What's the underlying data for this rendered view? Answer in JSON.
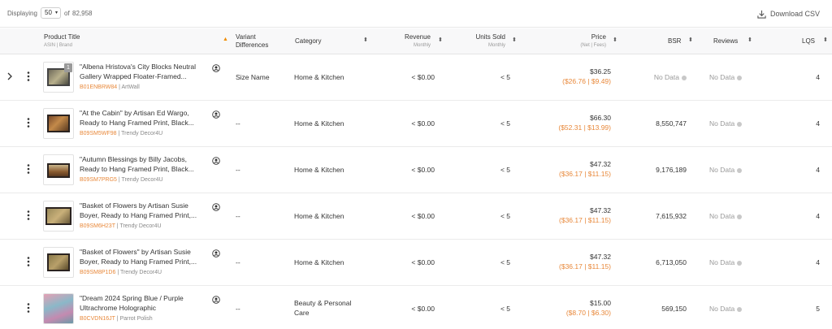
{
  "toolbar": {
    "displaying_label": "Displaying",
    "page_size": "50",
    "of_label": "of",
    "total": "82,958",
    "download_label": "Download CSV"
  },
  "columns": {
    "product_title": "Product Title",
    "product_sub": "ASIN | Brand",
    "variant": "Variant\nDifferences",
    "category": "Category",
    "revenue": "Revenue",
    "revenue_sub": "Monthly",
    "units": "Units Sold",
    "units_sub": "Monthly",
    "price": "Price",
    "price_sub": "(Net | Fees)",
    "bsr": "BSR",
    "reviews": "Reviews",
    "lqs": "LQS"
  },
  "rows": [
    {
      "title": "\"Albena Hristova's City Blocks Neutral\nGallery Wrapped Floater-Framed...",
      "asin": "B01ENBRW84",
      "brand": "ArtWall",
      "variant": "Size Name",
      "category": "Home & Kitchen",
      "revenue": "< $0.00",
      "units": "< 5",
      "price": "$36.25",
      "net": "($26.76",
      "fees": "$9.49)",
      "bsr": "No Data",
      "reviews": "No Data",
      "lqs": "4",
      "thumb_badge": "1"
    },
    {
      "title": "\"At the Cabin\" by Artisan Ed Wargo,\nReady to Hang Framed Print, Black...",
      "asin": "B09SM5WF98",
      "brand": "Trendy Decor4U",
      "variant": "--",
      "category": "Home & Kitchen",
      "revenue": "< $0.00",
      "units": "< 5",
      "price": "$66.30",
      "net": "($52.31",
      "fees": "$13.99)",
      "bsr": "8,550,747",
      "reviews": "No Data",
      "lqs": "4"
    },
    {
      "title": "\"Autumn Blessings by Billy Jacobs,\nReady to Hang Framed Print, Black...",
      "asin": "B09SM7PRG5",
      "brand": "Trendy Decor4U",
      "variant": "--",
      "category": "Home & Kitchen",
      "revenue": "< $0.00",
      "units": "< 5",
      "price": "$47.32",
      "net": "($36.17",
      "fees": "$11.15)",
      "bsr": "9,176,189",
      "reviews": "No Data",
      "lqs": "4"
    },
    {
      "title": "\"Basket of Flowers by Artisan Susie\nBoyer, Ready to Hang Framed Print,...",
      "asin": "B09SM6H23T",
      "brand": "Trendy Decor4U",
      "variant": "--",
      "category": "Home & Kitchen",
      "revenue": "< $0.00",
      "units": "< 5",
      "price": "$47.32",
      "net": "($36.17",
      "fees": "$11.15)",
      "bsr": "7,615,932",
      "reviews": "No Data",
      "lqs": "4"
    },
    {
      "title": "\"Basket of Flowers\" by Artisan Susie\nBoyer, Ready to Hang Framed Print,...",
      "asin": "B09SM8P1D6",
      "brand": "Trendy Decor4U",
      "variant": "--",
      "category": "Home & Kitchen",
      "revenue": "< $0.00",
      "units": "< 5",
      "price": "$47.32",
      "net": "($36.17",
      "fees": "$11.15)",
      "bsr": "6,713,050",
      "reviews": "No Data",
      "lqs": "4"
    },
    {
      "title": "\"Dream 2024 Spring Blue / Purple\nUltrachrome Holographic",
      "asin": "B0CVDN16JT",
      "brand": "Parrot Polish",
      "variant": "--",
      "category": "Beauty & Personal\nCare",
      "revenue": "< $0.00",
      "units": "< 5",
      "price": "$15.00",
      "net": "($8.70",
      "fees": "$6.30)",
      "bsr": "569,150",
      "reviews": "No Data",
      "lqs": "5"
    }
  ],
  "colors": {
    "accent": "#e8883a",
    "sort_active": "#f08c00"
  },
  "icons": {
    "download": "download-icon",
    "expander": "chevron-right-icon",
    "kebab": "more-vertical-icon",
    "variant": "user-circle-icon",
    "info": "info-icon"
  }
}
